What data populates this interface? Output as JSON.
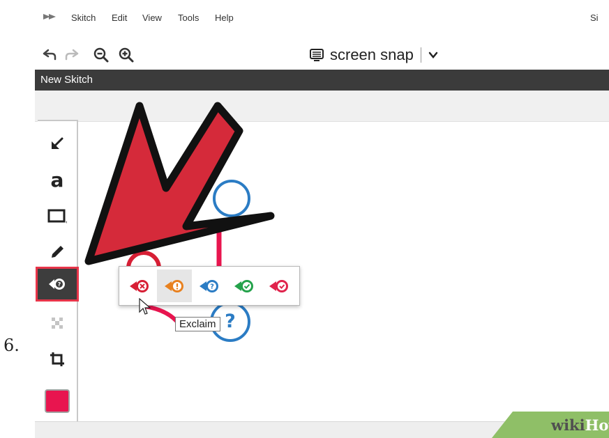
{
  "menu": {
    "items": [
      "Skitch",
      "Edit",
      "View",
      "Tools",
      "Help"
    ],
    "right_cutoff": "Si"
  },
  "toolbar": {
    "snap_label": "screen snap"
  },
  "document": {
    "title": "New Skitch"
  },
  "sidebar": {
    "tools": [
      "arrow",
      "text",
      "rectangle",
      "marker",
      "stamp",
      "pixelate",
      "crop",
      "color"
    ],
    "text_tool_glyph": "a",
    "selected_tool": "stamp",
    "color": "#e8154f"
  },
  "stamp_popup": {
    "options": [
      {
        "name": "reject",
        "color": "#d71f35"
      },
      {
        "name": "exclaim",
        "color": "#e8811f"
      },
      {
        "name": "question",
        "color": "#2b7cc4"
      },
      {
        "name": "approve",
        "color": "#24a24b"
      },
      {
        "name": "favorite",
        "color": "#e0234c"
      }
    ],
    "hovered": "exclaim",
    "tooltip": "Exclaim"
  },
  "canvas": {
    "badge_glyph": "?"
  },
  "step_number": "6.",
  "watermark": {
    "part1": "wiki",
    "part2": "How"
  },
  "colors": {
    "arrow_red": "#d52a3a",
    "accent_pink": "#e8154f",
    "titlebar": "#3b3b3b",
    "question_blue": "#2b7cc4",
    "wikihow_green": "#8fbf67"
  }
}
